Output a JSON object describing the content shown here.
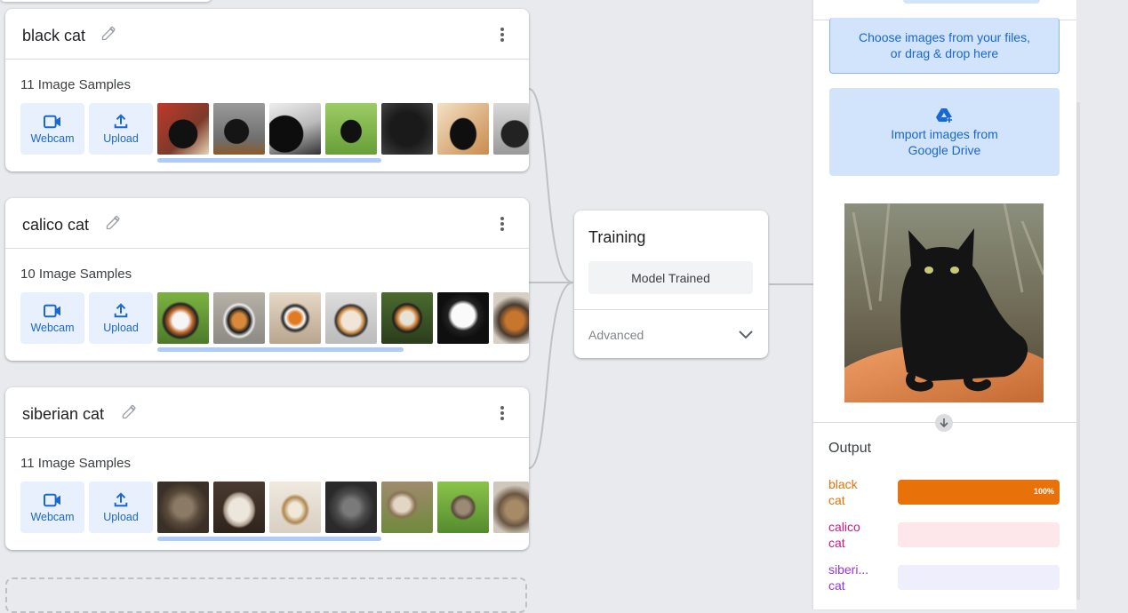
{
  "classes": [
    {
      "name": "black cat",
      "samples": "11 Image Samples",
      "webcam_label": "Webcam",
      "upload_label": "Upload"
    },
    {
      "name": "calico cat",
      "samples": "10 Image Samples",
      "webcam_label": "Webcam",
      "upload_label": "Upload"
    },
    {
      "name": "siberian cat",
      "samples": "11 Image Samples",
      "webcam_label": "Webcam",
      "upload_label": "Upload"
    }
  ],
  "icons": {
    "edit": "pencil-icon",
    "menu": "more-vert-icon",
    "webcam": "videocam-icon",
    "upload": "upload-icon",
    "drive": "google-drive-add-icon",
    "expand": "chevron-down-icon",
    "arrow": "arrow-down-icon"
  },
  "training": {
    "title": "Training",
    "status_button": "Model Trained",
    "advanced_label": "Advanced"
  },
  "preview_panel": {
    "upload_line1": "Choose images from your files,",
    "upload_line2": "or drag & drop here",
    "drive_line1": "Import images from",
    "drive_line2": "Google Drive"
  },
  "output": {
    "title": "Output",
    "results": [
      {
        "label_line1": "black",
        "label_line2": "cat",
        "confidence": 1.0,
        "percent_text": "100%",
        "color": "#e8710a",
        "track": "#fce8d5"
      },
      {
        "label_line1": "calico",
        "label_line2": "cat",
        "confidence": 0.0,
        "percent_text": "",
        "color": "#d01884",
        "track": "#fde7ea"
      },
      {
        "label_line1": "siberi...",
        "label_line2": "cat",
        "confidence": 0.0,
        "percent_text": "",
        "color": "#9334e6",
        "track": "#efeefd"
      }
    ]
  },
  "colors": {
    "accent_blue": "#1967d2",
    "button_bg": "#e8f0fe",
    "import_bg": "#d2e3fc"
  }
}
